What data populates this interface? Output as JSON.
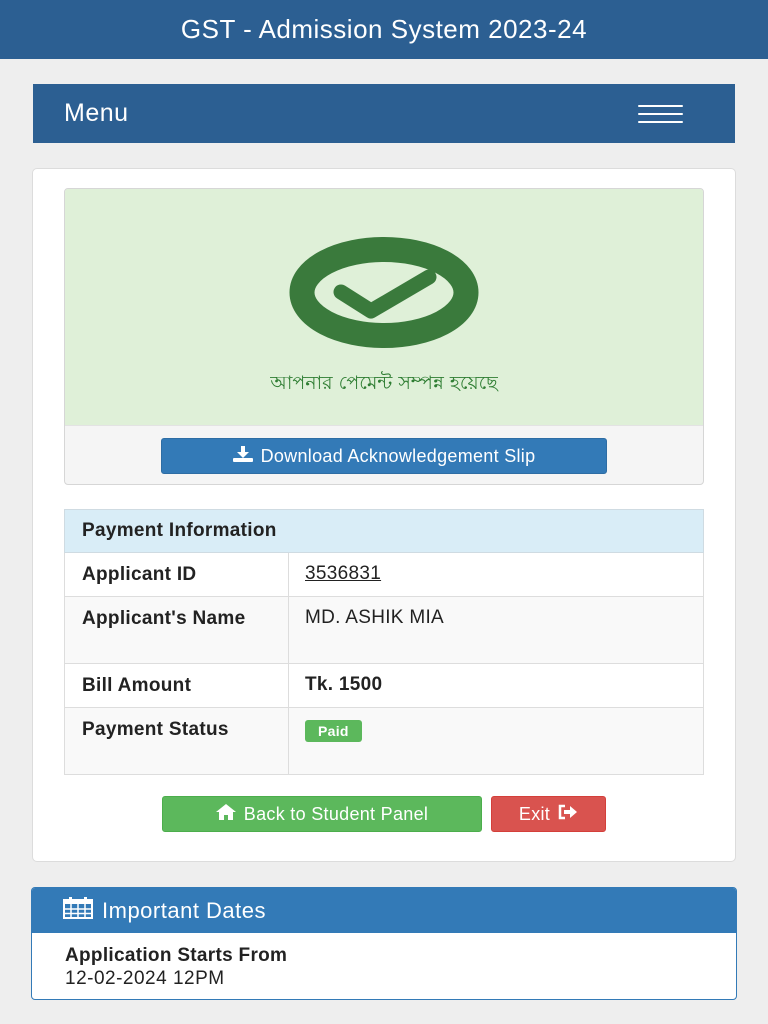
{
  "header": {
    "title": "GST - Admission System 2023-24"
  },
  "menu": {
    "label": "Menu",
    "icon": "hamburger-icon"
  },
  "success": {
    "icon": "check-circle-icon",
    "message": "আপনার পেমেন্ট সম্পন্ন হয়েছে",
    "download_label": "Download Acknowledgement Slip",
    "download_icon": "download-icon",
    "color": "#3a7a3c"
  },
  "payment_info": {
    "title": "Payment Information",
    "rows": [
      {
        "label": "Applicant ID",
        "value": "3536831"
      },
      {
        "label": "Applicant's Name",
        "value": "MD. ASHIK MIA"
      },
      {
        "label": "Bill Amount",
        "value": "Tk. 1500"
      },
      {
        "label": "Payment Status",
        "value": "Paid"
      }
    ]
  },
  "actions": {
    "back_label": "Back to Student Panel",
    "back_icon": "home-icon",
    "exit_label": "Exit",
    "exit_icon": "sign-out-icon"
  },
  "important_dates": {
    "title": "Important Dates",
    "icon": "calendar-icon",
    "label": "Application Starts From",
    "value": "12-02-2024 12PM"
  },
  "colors": {
    "primary": "#2c5f92",
    "info": "#337ab7",
    "success": "#5cb85c",
    "danger": "#d9534f",
    "success_bg": "#dff0d8"
  }
}
